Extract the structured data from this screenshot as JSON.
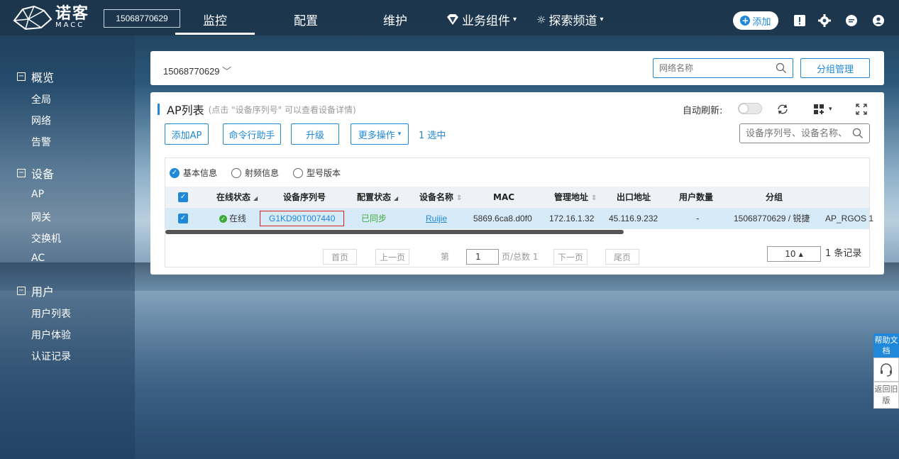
{
  "brand": {
    "name_cn": "诺客",
    "name_en": "MACC"
  },
  "topbar": {
    "account": "15068770629",
    "nav": [
      "监控",
      "配置",
      "维护"
    ],
    "nav_dropdowns": [
      "业务组件",
      "探索频道"
    ],
    "add_label": "添加"
  },
  "sidebar": {
    "sections": [
      {
        "title": "概览",
        "items": [
          "全局",
          "网络",
          "告警"
        ]
      },
      {
        "title": "设备",
        "items": [
          "AP",
          "网关",
          "交换机",
          "AC"
        ]
      },
      {
        "title": "用户",
        "items": [
          "用户列表",
          "用户体验",
          "认证记录"
        ]
      }
    ]
  },
  "filter_bar": {
    "account": "15068770629",
    "network_placeholder": "网络名称",
    "group_manage": "分组管理"
  },
  "ap_panel": {
    "title": "AP列表",
    "hint": "(点击 \"设备序列号\" 可以查看设备详情)",
    "auto_refresh": "自动刷新:",
    "actions": [
      "添加AP",
      "命令行助手",
      "升级",
      "更多操作"
    ],
    "selected": "1 选中",
    "search_placeholder": "设备序列号、设备名称、",
    "view_tabs": [
      "基本信息",
      "射频信息",
      "型号版本"
    ],
    "columns": [
      "在线状态",
      "设备序列号",
      "配置状态",
      "设备名称",
      "MAC",
      "管理地址",
      "出口地址",
      "用户数量",
      "分组"
    ],
    "row": {
      "status": "在线",
      "serial": "G1KD90T007440",
      "config_status": "已同步",
      "name": "Ruijie",
      "mac": "5869.6ca8.d0f0",
      "mgmt_ip": "172.16.1.32",
      "egress_ip": "45.116.9.232",
      "users": "-",
      "group": "15068770629 / 锐捷",
      "model": "AP_RGOS 1"
    },
    "pager": {
      "first": "首页",
      "prev": "上一页",
      "page_label": "第",
      "page": "1",
      "total": "页/总数 1",
      "next": "下一页",
      "last": "尾页",
      "page_size": "10",
      "records": "1 条记录"
    }
  },
  "float_help": {
    "help": "帮助文档",
    "old": "返回旧版"
  },
  "colors": {
    "accent": "#1f88d8",
    "success": "#3dab3b",
    "danger": "#e02020"
  }
}
